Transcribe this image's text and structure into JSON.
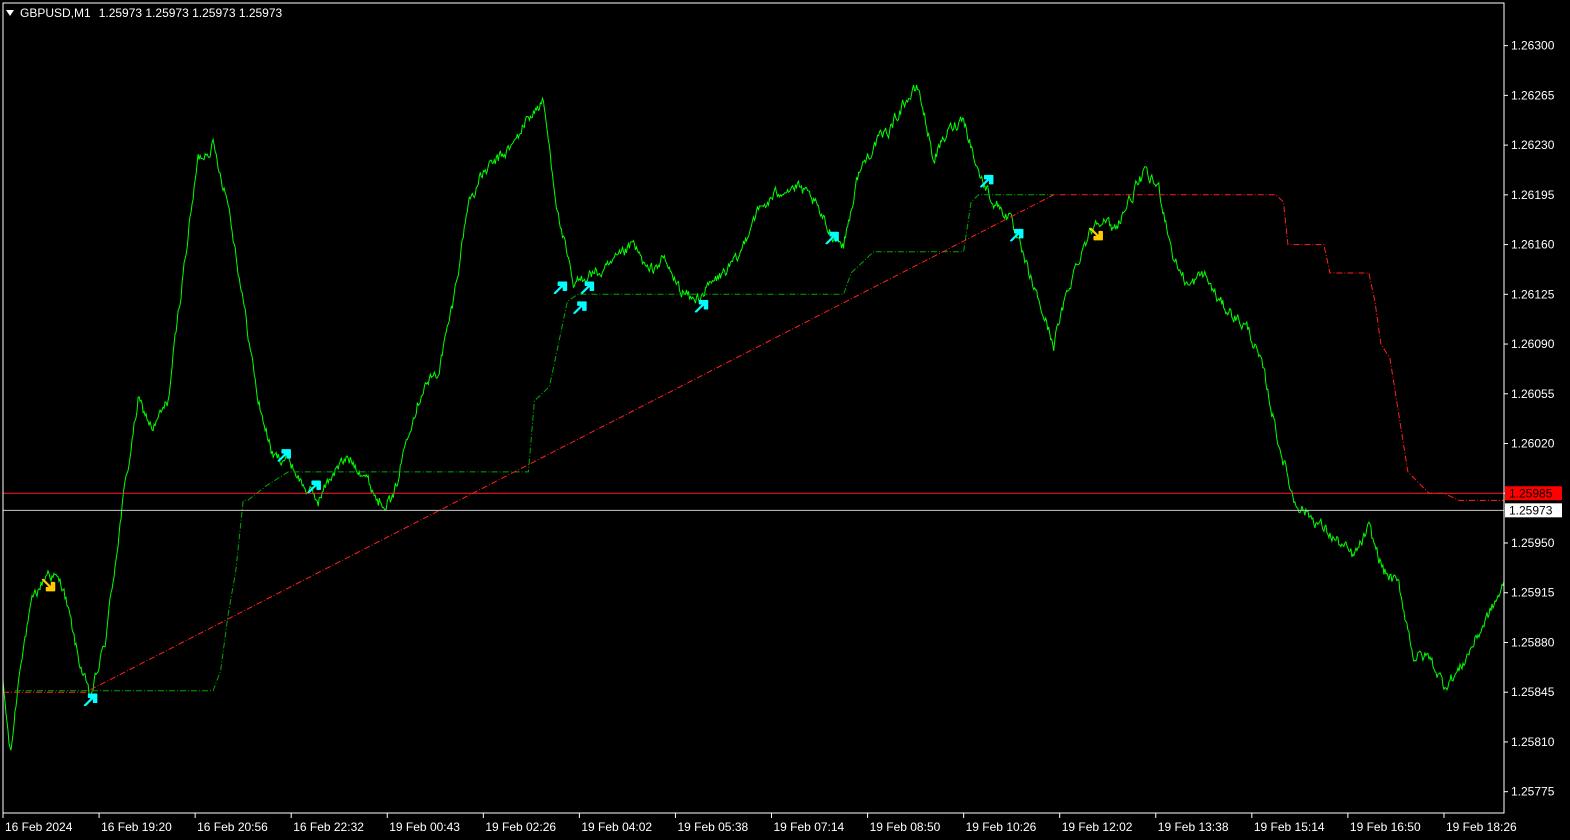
{
  "header": {
    "symbol": "GBPUSD,M1",
    "ohlc": "1.25973 1.25973 1.25973 1.25973"
  },
  "colors": {
    "background": "#000000",
    "frame": "#ffffff",
    "price_line": "#00ff00",
    "stop_long": "#00a800",
    "stop_short": "#ff2020",
    "arrow_up": "#00ffff",
    "arrow_down": "#ffcc00",
    "ask_line": "#ff2020",
    "bid_line": "#c8c8c8",
    "bid_label_bg": "#ffffff",
    "bid_label_text": "#000000",
    "ask_label_bg": "#ff0000",
    "ask_label_text": "#000000"
  },
  "chart_data": {
    "type": "line",
    "title": "GBPUSD,M1",
    "ylim": [
      1.2576,
      1.2633
    ],
    "xlim": [
      0,
      100
    ],
    "grid": false,
    "y_ticks": [
      "1.26300",
      "1.26265",
      "1.26230",
      "1.26195",
      "1.26160",
      "1.26125",
      "1.26090",
      "1.26055",
      "1.26020",
      "1.25985",
      "1.25950",
      "1.25915",
      "1.25880",
      "1.25845",
      "1.25810",
      "1.25775"
    ],
    "x_ticks": [
      {
        "label": "16 Feb 2024",
        "x": 0
      },
      {
        "label": "16 Feb 19:20",
        "x": 6.4
      },
      {
        "label": "16 Feb 20:56",
        "x": 12.8
      },
      {
        "label": "16 Feb 22:32",
        "x": 19.2
      },
      {
        "label": "19 Feb 00:43",
        "x": 25.6
      },
      {
        "label": "19 Feb 02:26",
        "x": 32.0
      },
      {
        "label": "19 Feb 04:02",
        "x": 38.4
      },
      {
        "label": "19 Feb 05:38",
        "x": 44.8
      },
      {
        "label": "19 Feb 07:14",
        "x": 51.2
      },
      {
        "label": "19 Feb 08:50",
        "x": 57.6
      },
      {
        "label": "19 Feb 10:26",
        "x": 64.0
      },
      {
        "label": "19 Feb 12:02",
        "x": 70.4
      },
      {
        "label": "19 Feb 13:38",
        "x": 76.8
      },
      {
        "label": "19 Feb 15:14",
        "x": 83.2
      },
      {
        "label": "19 Feb 16:50",
        "x": 89.6
      },
      {
        "label": "19 Feb 18:26",
        "x": 96.0
      }
    ],
    "series": [
      {
        "role": "price",
        "points": [
          [
            0,
            1.2585
          ],
          [
            0.5,
            1.258
          ],
          [
            1.2,
            1.2587
          ],
          [
            2,
            1.2591
          ],
          [
            3,
            1.2593
          ],
          [
            4,
            1.2592
          ],
          [
            5,
            1.2587
          ],
          [
            5.8,
            1.2584
          ],
          [
            6.8,
            1.2588
          ],
          [
            8,
            1.2598
          ],
          [
            9,
            1.2605
          ],
          [
            10,
            1.2603
          ],
          [
            11,
            1.2605
          ],
          [
            12,
            1.2614
          ],
          [
            13,
            1.2622
          ],
          [
            14,
            1.2623
          ],
          [
            15,
            1.2619
          ],
          [
            16,
            1.2612
          ],
          [
            17,
            1.2605
          ],
          [
            18,
            1.2601
          ],
          [
            19,
            1.2601
          ],
          [
            20,
            1.2599
          ],
          [
            21,
            1.2598
          ],
          [
            22,
            1.26
          ],
          [
            23,
            1.2601
          ],
          [
            24,
            1.26
          ],
          [
            25,
            1.2598
          ],
          [
            26,
            1.2598
          ],
          [
            27,
            1.2603
          ],
          [
            28,
            1.2606
          ],
          [
            29,
            1.2607
          ],
          [
            30,
            1.2612
          ],
          [
            31,
            1.2619
          ],
          [
            32,
            1.2621
          ],
          [
            33,
            1.2622
          ],
          [
            34,
            1.2623
          ],
          [
            35,
            1.2625
          ],
          [
            36,
            1.2626
          ],
          [
            37,
            1.2618
          ],
          [
            38,
            1.2613
          ],
          [
            39,
            1.2614
          ],
          [
            40,
            1.2614
          ],
          [
            41,
            1.2615
          ],
          [
            42,
            1.2616
          ],
          [
            43,
            1.2614
          ],
          [
            44,
            1.2615
          ],
          [
            45,
            1.2613
          ],
          [
            46,
            1.2612
          ],
          [
            47,
            1.2613
          ],
          [
            48,
            1.2614
          ],
          [
            49,
            1.2615
          ],
          [
            50,
            1.2618
          ],
          [
            51,
            1.2619
          ],
          [
            52,
            1.262
          ],
          [
            53,
            1.262
          ],
          [
            54,
            1.2619
          ],
          [
            55,
            1.2617
          ],
          [
            56,
            1.2616
          ],
          [
            57,
            1.2621
          ],
          [
            58,
            1.2623
          ],
          [
            59,
            1.2624
          ],
          [
            60,
            1.2626
          ],
          [
            61,
            1.2627
          ],
          [
            62,
            1.2622
          ],
          [
            63,
            1.2624
          ],
          [
            64,
            1.2625
          ],
          [
            65,
            1.2621
          ],
          [
            66,
            1.2619
          ],
          [
            67,
            1.2618
          ],
          [
            68,
            1.2615
          ],
          [
            69,
            1.2612
          ],
          [
            70,
            1.2609
          ],
          [
            71,
            1.2613
          ],
          [
            72,
            1.2616
          ],
          [
            73,
            1.2618
          ],
          [
            74,
            1.2617
          ],
          [
            75,
            1.2619
          ],
          [
            76,
            1.2621
          ],
          [
            77,
            1.262
          ],
          [
            78,
            1.2615
          ],
          [
            79,
            1.2613
          ],
          [
            80,
            1.2614
          ],
          [
            81,
            1.2612
          ],
          [
            82,
            1.2611
          ],
          [
            83,
            1.261
          ],
          [
            84,
            1.2607
          ],
          [
            85,
            1.2602
          ],
          [
            86,
            1.2598
          ],
          [
            87,
            1.2597
          ],
          [
            88,
            1.2596
          ],
          [
            89,
            1.2595
          ],
          [
            90,
            1.2594
          ],
          [
            91,
            1.2596
          ],
          [
            92,
            1.2593
          ],
          [
            93,
            1.2592
          ],
          [
            94,
            1.2587
          ],
          [
            95,
            1.2587
          ],
          [
            96,
            1.2585
          ],
          [
            97,
            1.2586
          ],
          [
            98,
            1.2588
          ],
          [
            99,
            1.259
          ],
          [
            100,
            1.2592
          ]
        ]
      },
      {
        "role": "trailing-stop-long",
        "points": [
          [
            0.8,
            1.25846
          ],
          [
            5.5,
            1.25846
          ],
          [
            14,
            1.25846
          ],
          [
            14.5,
            1.2586
          ],
          [
            15,
            1.259
          ],
          [
            15.5,
            1.2593
          ],
          [
            16,
            1.2598
          ],
          [
            16.3,
            1.2598
          ],
          [
            17.5,
            1.2599
          ],
          [
            19,
            1.26
          ],
          [
            35,
            1.26
          ],
          [
            35.4,
            1.2605
          ],
          [
            36.4,
            1.2606
          ],
          [
            37,
            1.2609
          ],
          [
            37.6,
            1.2612
          ],
          [
            38.3,
            1.26125
          ],
          [
            38.8,
            1.26125
          ],
          [
            56,
            1.26125
          ],
          [
            56.5,
            1.2614
          ],
          [
            58,
            1.26155
          ],
          [
            64,
            1.26155
          ],
          [
            64.5,
            1.2619
          ],
          [
            65,
            1.26195
          ],
          [
            70,
            1.26195
          ]
        ]
      },
      {
        "role": "trailing-stop-short",
        "points": [
          [
            0,
            1.25845
          ],
          [
            5.5,
            1.25845
          ],
          [
            70,
            1.26195
          ],
          [
            84.8,
            1.26195
          ],
          [
            85.3,
            1.2619
          ],
          [
            85.6,
            1.2616
          ],
          [
            88,
            1.2616
          ],
          [
            88.4,
            1.2614
          ],
          [
            91,
            1.2614
          ],
          [
            91.4,
            1.2612
          ],
          [
            91.8,
            1.2609
          ],
          [
            92.4,
            1.2608
          ],
          [
            93,
            1.2604
          ],
          [
            93.6,
            1.26
          ],
          [
            95,
            1.25985
          ],
          [
            96,
            1.25985
          ],
          [
            97,
            1.2598
          ],
          [
            100,
            1.2598
          ],
          [
            100,
            1.2595
          ]
        ]
      }
    ],
    "arrows": [
      {
        "dir": "down",
        "x": 3.1,
        "y": 1.2592
      },
      {
        "dir": "up",
        "x": 5.9,
        "y": 1.2584
      },
      {
        "dir": "up",
        "x": 18.8,
        "y": 1.26012
      },
      {
        "dir": "up",
        "x": 20.8,
        "y": 1.2599
      },
      {
        "dir": "up",
        "x": 37.2,
        "y": 1.2613
      },
      {
        "dir": "up",
        "x": 38.5,
        "y": 1.26116
      },
      {
        "dir": "up",
        "x": 39.0,
        "y": 1.2613
      },
      {
        "dir": "up",
        "x": 46.6,
        "y": 1.26117
      },
      {
        "dir": "up",
        "x": 55.3,
        "y": 1.26165
      },
      {
        "dir": "up",
        "x": 65.6,
        "y": 1.26205
      },
      {
        "dir": "up",
        "x": 67.6,
        "y": 1.26167
      },
      {
        "dir": "down",
        "x": 72.9,
        "y": 1.26167
      }
    ],
    "ask_level": {
      "value": 1.25985,
      "label": "1.25985"
    },
    "bid_level": {
      "value": 1.25973,
      "label": "1.25973"
    }
  }
}
